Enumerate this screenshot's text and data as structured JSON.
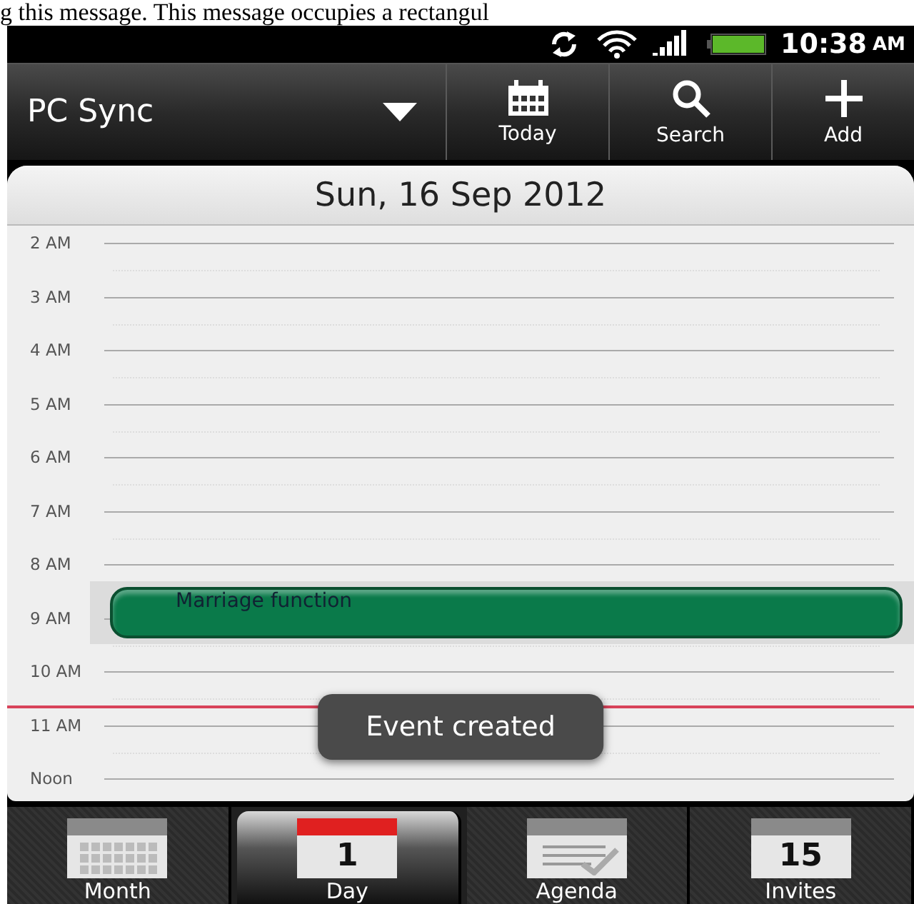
{
  "page_caption": "g this message. This message occupies a rectangul",
  "status_bar": {
    "time": "10:38",
    "meridiem": "AM",
    "battery": {
      "level": 1
    }
  },
  "action_bar": {
    "title": "PC Sync",
    "buttons": [
      {
        "kind": "today",
        "label": "Today"
      },
      {
        "kind": "search",
        "label": "Search"
      },
      {
        "kind": "add",
        "label": "Add"
      }
    ]
  },
  "day_header": "Sun, 16 Sep 2012",
  "hours": [
    {
      "label": "2 AM"
    },
    {
      "label": "3 AM"
    },
    {
      "label": "4 AM"
    },
    {
      "label": "5 AM"
    },
    {
      "label": "6 AM"
    },
    {
      "label": "7 AM"
    },
    {
      "label": "8 AM",
      "event": {
        "title": "Marriage function",
        "color": "#0a7a4a"
      }
    },
    {
      "label": "9 AM"
    },
    {
      "label": "10 AM",
      "now": true
    },
    {
      "label": "11 AM"
    },
    {
      "label": "Noon"
    }
  ],
  "toast": "Event created",
  "tabs": [
    {
      "kind": "month",
      "label": "Month",
      "selected": false
    },
    {
      "kind": "day",
      "label": "Day",
      "selected": true,
      "icon_number": "1"
    },
    {
      "kind": "agenda",
      "label": "Agenda",
      "selected": false
    },
    {
      "kind": "invites",
      "label": "Invites",
      "selected": false,
      "icon_number": "15"
    }
  ]
}
